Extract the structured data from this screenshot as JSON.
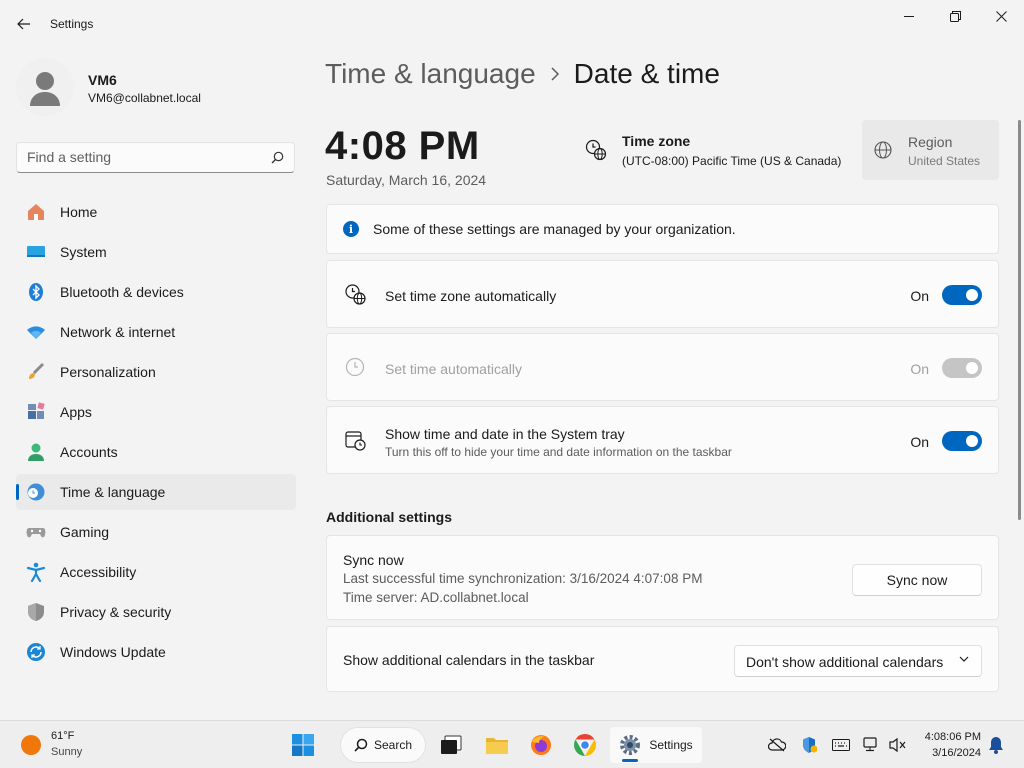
{
  "window": {
    "title": "Settings"
  },
  "profile": {
    "name": "VM6",
    "email": "VM6@collabnet.local"
  },
  "search": {
    "placeholder": "Find a setting"
  },
  "nav": {
    "items": [
      {
        "label": "Home",
        "icon": "home-icon"
      },
      {
        "label": "System",
        "icon": "system-icon"
      },
      {
        "label": "Bluetooth & devices",
        "icon": "bluetooth-icon"
      },
      {
        "label": "Network & internet",
        "icon": "wifi-icon"
      },
      {
        "label": "Personalization",
        "icon": "brush-icon"
      },
      {
        "label": "Apps",
        "icon": "apps-icon"
      },
      {
        "label": "Accounts",
        "icon": "accounts-icon"
      },
      {
        "label": "Time & language",
        "icon": "time-language-icon",
        "selected": true
      },
      {
        "label": "Gaming",
        "icon": "gamepad-icon"
      },
      {
        "label": "Accessibility",
        "icon": "accessibility-icon"
      },
      {
        "label": "Privacy & security",
        "icon": "shield-icon"
      },
      {
        "label": "Windows Update",
        "icon": "update-icon"
      }
    ]
  },
  "header": {
    "parent": "Time & language",
    "current": "Date & time"
  },
  "clock_display": {
    "time": "4:08 PM",
    "date": "Saturday, March 16, 2024"
  },
  "timezone": {
    "label": "Time zone",
    "value": "(UTC-08:00) Pacific Time (US & Canada)"
  },
  "region": {
    "label": "Region",
    "value": "United States"
  },
  "notice": {
    "text": "Some of these settings are managed by your organization."
  },
  "settings": {
    "auto_timezone": {
      "label": "Set time zone automatically",
      "state": "On",
      "enabled": true
    },
    "auto_time": {
      "label": "Set time automatically",
      "state": "On",
      "enabled": false
    },
    "show_tray": {
      "label": "Show time and date in the System tray",
      "description": "Turn this off to hide your time and date information on the taskbar",
      "state": "On",
      "enabled": true
    }
  },
  "additional": {
    "title": "Additional settings",
    "sync": {
      "title": "Sync now",
      "last_sync": "Last successful time synchronization: 3/16/2024 4:07:08 PM",
      "server": "Time server: AD.collabnet.local",
      "button": "Sync now"
    },
    "calendars": {
      "label": "Show additional calendars in the taskbar",
      "selected": "Don't show additional calendars"
    }
  },
  "taskbar": {
    "weather_temp": "61°F",
    "weather_desc": "Sunny",
    "search_label": "Search",
    "settings_label": "Settings",
    "clock_time": "4:08:06 PM",
    "clock_date": "3/16/2024"
  },
  "colors": {
    "accent": "#0067c0",
    "background": "#f3f3f3",
    "card": "#fbfbfb"
  }
}
